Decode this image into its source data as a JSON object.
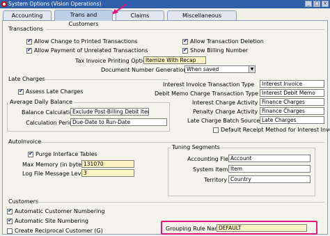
{
  "window": {
    "title": "System Options (Vision Operations)"
  },
  "tabs": [
    {
      "label": "Accounting"
    },
    {
      "label": "Trans and Customers"
    },
    {
      "label": "Claims"
    },
    {
      "label": "Miscellaneous"
    }
  ],
  "transactions": {
    "header": "Transactions",
    "allow_change_printed": {
      "label": "Allow Change to Printed Transactions",
      "checked": true
    },
    "allow_payment_unrelated": {
      "label": "Allow Payment of Unrelated Transactions",
      "checked": true
    },
    "allow_deletion": {
      "label": "Allow Transaction Deletion",
      "checked": true
    },
    "show_billing_number": {
      "label": "Show Billing Number",
      "checked": true
    },
    "tax_invoice_label": "Tax Invoice Printing Options",
    "tax_invoice_value": "Itemize With Recap",
    "doc_number_label": "Document Number Generation Level",
    "doc_number_value": "When saved"
  },
  "late_charges": {
    "header": "Late Charges",
    "assess": {
      "label": "Assess Late Charges",
      "checked": true
    },
    "avg_daily_balance": {
      "header": "Average Daily Balance",
      "balance_calc_label": "Balance Calculation",
      "balance_calc_value": "Exclude Post-Billing Debit Items",
      "calc_period_label": "Calculation Period",
      "calc_period_value": "Due-Date to Run-Date"
    },
    "interest_invoice_type_label": "Interest Invoice Transaction Type",
    "interest_invoice_type_value": "Interest Invoice",
    "debit_memo_type_label": "Debit Memo Charge Transaction Type",
    "debit_memo_type_value": "Interest Debit Memo",
    "interest_activity_label": "Interest Charge Activity",
    "interest_activity_value": "Finance Charges",
    "penalty_activity_label": "Penalty Charge Activity",
    "penalty_activity_value": "Finance Charges",
    "batch_source_label": "Late Charge Batch Source",
    "batch_source_value": "Late Charges",
    "default_receipt": {
      "label": "Default Receipt Method for Interest Invoice",
      "checked": false
    }
  },
  "autoinvoice": {
    "header": "AutoInvoice",
    "purge": {
      "label": "Purge Interface Tables",
      "checked": true
    },
    "max_memory_label": "Max Memory (in bytes)",
    "max_memory_value": "131070",
    "log_file_label": "Log File Message Level",
    "log_file_value": "3",
    "tuning": {
      "header": "Tuning Segments",
      "accounting_flex_label": "Accounting Flex",
      "accounting_flex_value": "Account",
      "system_items_label": "System Items",
      "system_items_value": "Item",
      "territory_label": "Territory",
      "territory_value": "Country"
    }
  },
  "customers": {
    "header": "Customers",
    "auto_customer_numbering": {
      "label": "Automatic Customer Numbering",
      "checked": true
    },
    "auto_site_numbering": {
      "label": "Automatic Site Numbering",
      "checked": true
    },
    "create_reciprocal": {
      "label": "Create Reciprocal Customer (G)",
      "checked": false
    },
    "grouping_rule_label": "Grouping Rule Name",
    "grouping_rule_value": "DEFAULT"
  },
  "colors": {
    "title_bar": "#2f5fa8",
    "highlight": "#e0167a",
    "required_field": "#fbf3c2"
  }
}
